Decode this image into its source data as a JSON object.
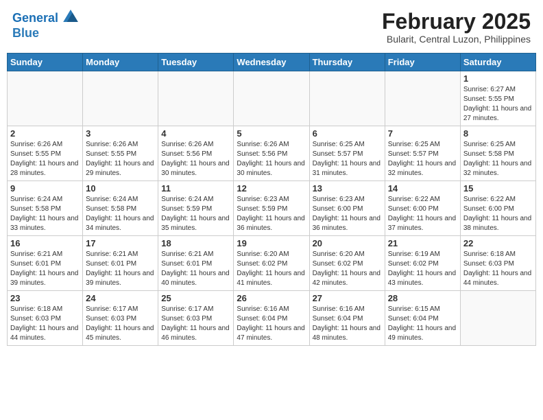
{
  "header": {
    "logo_line1": "General",
    "logo_line2": "Blue",
    "month_title": "February 2025",
    "subtitle": "Bularit, Central Luzon, Philippines"
  },
  "weekdays": [
    "Sunday",
    "Monday",
    "Tuesday",
    "Wednesday",
    "Thursday",
    "Friday",
    "Saturday"
  ],
  "weeks": [
    [
      {
        "day": "",
        "info": ""
      },
      {
        "day": "",
        "info": ""
      },
      {
        "day": "",
        "info": ""
      },
      {
        "day": "",
        "info": ""
      },
      {
        "day": "",
        "info": ""
      },
      {
        "day": "",
        "info": ""
      },
      {
        "day": "1",
        "info": "Sunrise: 6:27 AM\nSunset: 5:55 PM\nDaylight: 11 hours and 27 minutes."
      }
    ],
    [
      {
        "day": "2",
        "info": "Sunrise: 6:26 AM\nSunset: 5:55 PM\nDaylight: 11 hours and 28 minutes."
      },
      {
        "day": "3",
        "info": "Sunrise: 6:26 AM\nSunset: 5:55 PM\nDaylight: 11 hours and 29 minutes."
      },
      {
        "day": "4",
        "info": "Sunrise: 6:26 AM\nSunset: 5:56 PM\nDaylight: 11 hours and 30 minutes."
      },
      {
        "day": "5",
        "info": "Sunrise: 6:26 AM\nSunset: 5:56 PM\nDaylight: 11 hours and 30 minutes."
      },
      {
        "day": "6",
        "info": "Sunrise: 6:25 AM\nSunset: 5:57 PM\nDaylight: 11 hours and 31 minutes."
      },
      {
        "day": "7",
        "info": "Sunrise: 6:25 AM\nSunset: 5:57 PM\nDaylight: 11 hours and 32 minutes."
      },
      {
        "day": "8",
        "info": "Sunrise: 6:25 AM\nSunset: 5:58 PM\nDaylight: 11 hours and 32 minutes."
      }
    ],
    [
      {
        "day": "9",
        "info": "Sunrise: 6:24 AM\nSunset: 5:58 PM\nDaylight: 11 hours and 33 minutes."
      },
      {
        "day": "10",
        "info": "Sunrise: 6:24 AM\nSunset: 5:58 PM\nDaylight: 11 hours and 34 minutes."
      },
      {
        "day": "11",
        "info": "Sunrise: 6:24 AM\nSunset: 5:59 PM\nDaylight: 11 hours and 35 minutes."
      },
      {
        "day": "12",
        "info": "Sunrise: 6:23 AM\nSunset: 5:59 PM\nDaylight: 11 hours and 36 minutes."
      },
      {
        "day": "13",
        "info": "Sunrise: 6:23 AM\nSunset: 6:00 PM\nDaylight: 11 hours and 36 minutes."
      },
      {
        "day": "14",
        "info": "Sunrise: 6:22 AM\nSunset: 6:00 PM\nDaylight: 11 hours and 37 minutes."
      },
      {
        "day": "15",
        "info": "Sunrise: 6:22 AM\nSunset: 6:00 PM\nDaylight: 11 hours and 38 minutes."
      }
    ],
    [
      {
        "day": "16",
        "info": "Sunrise: 6:21 AM\nSunset: 6:01 PM\nDaylight: 11 hours and 39 minutes."
      },
      {
        "day": "17",
        "info": "Sunrise: 6:21 AM\nSunset: 6:01 PM\nDaylight: 11 hours and 39 minutes."
      },
      {
        "day": "18",
        "info": "Sunrise: 6:21 AM\nSunset: 6:01 PM\nDaylight: 11 hours and 40 minutes."
      },
      {
        "day": "19",
        "info": "Sunrise: 6:20 AM\nSunset: 6:02 PM\nDaylight: 11 hours and 41 minutes."
      },
      {
        "day": "20",
        "info": "Sunrise: 6:20 AM\nSunset: 6:02 PM\nDaylight: 11 hours and 42 minutes."
      },
      {
        "day": "21",
        "info": "Sunrise: 6:19 AM\nSunset: 6:02 PM\nDaylight: 11 hours and 43 minutes."
      },
      {
        "day": "22",
        "info": "Sunrise: 6:18 AM\nSunset: 6:03 PM\nDaylight: 11 hours and 44 minutes."
      }
    ],
    [
      {
        "day": "23",
        "info": "Sunrise: 6:18 AM\nSunset: 6:03 PM\nDaylight: 11 hours and 44 minutes."
      },
      {
        "day": "24",
        "info": "Sunrise: 6:17 AM\nSunset: 6:03 PM\nDaylight: 11 hours and 45 minutes."
      },
      {
        "day": "25",
        "info": "Sunrise: 6:17 AM\nSunset: 6:03 PM\nDaylight: 11 hours and 46 minutes."
      },
      {
        "day": "26",
        "info": "Sunrise: 6:16 AM\nSunset: 6:04 PM\nDaylight: 11 hours and 47 minutes."
      },
      {
        "day": "27",
        "info": "Sunrise: 6:16 AM\nSunset: 6:04 PM\nDaylight: 11 hours and 48 minutes."
      },
      {
        "day": "28",
        "info": "Sunrise: 6:15 AM\nSunset: 6:04 PM\nDaylight: 11 hours and 49 minutes."
      },
      {
        "day": "",
        "info": ""
      }
    ]
  ]
}
